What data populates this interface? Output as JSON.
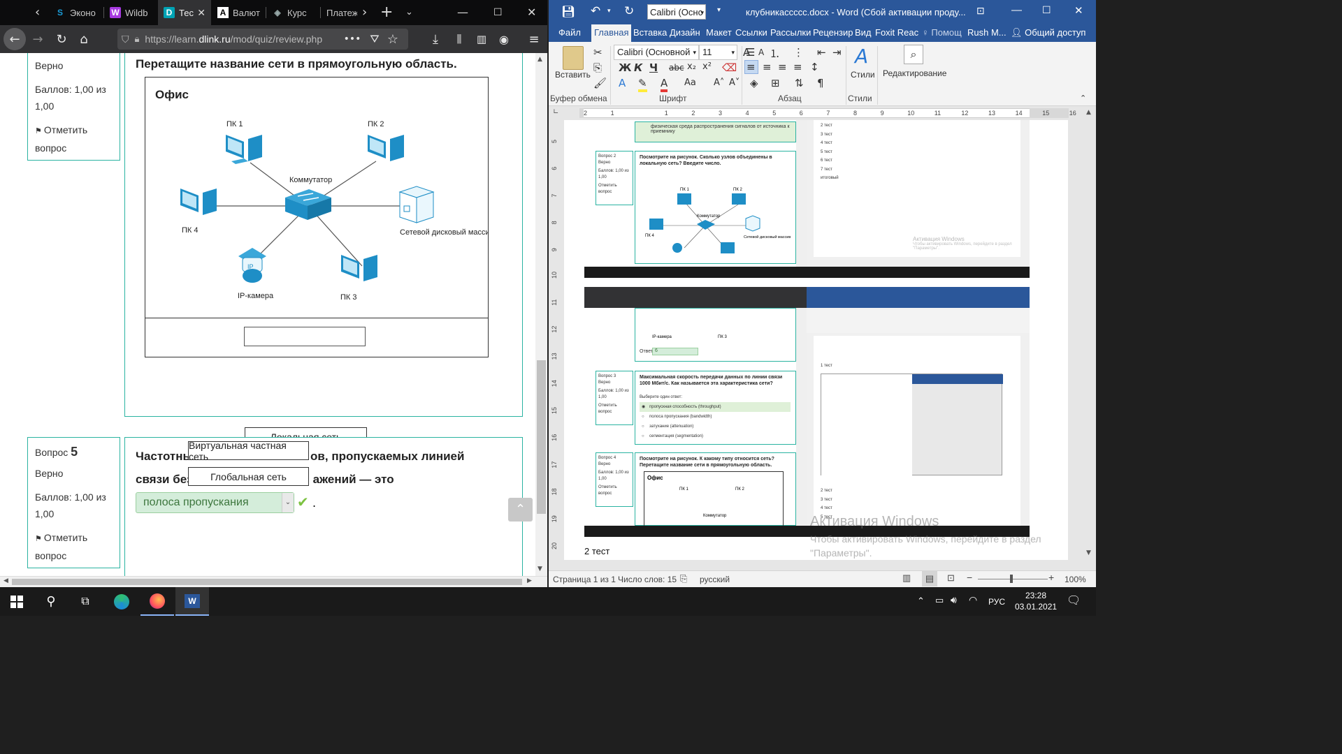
{
  "firefox": {
    "tabs": [
      {
        "label": "Эконо",
        "favicon": "S",
        "color": "#1a9bd7"
      },
      {
        "label": "Wildb",
        "favicon": "W",
        "color": "#a73ae0"
      },
      {
        "label": "Тес",
        "favicon": "D",
        "color": "#00a3b4"
      },
      {
        "label": "Валют",
        "favicon": "A",
        "color": "#ffffff"
      },
      {
        "label": "Курс",
        "favicon": "◈",
        "color": "#9aa"
      },
      {
        "label": "Платеж",
        "favicon": "",
        "color": "#ccc"
      }
    ],
    "url": {
      "prefix": "https://learn.",
      "host": "dlink.ru",
      "path": "/mod/quiz/review.php"
    },
    "q4": {
      "status": "Верно",
      "score": "Баллов: 1,00 из 1,00",
      "flag": "Отметить вопрос",
      "text": "Перетащите название сети в прямоугольную область.",
      "diagram": {
        "title": "Офис",
        "pc1": "ПК 1",
        "pc2": "ПК 2",
        "pc3": "ПК 3",
        "pc4": "ПК 4",
        "switch": "Коммутатор",
        "nas": "Сетевой дисковый массив",
        "camera": "IP-камера",
        "cam_ip": "IP"
      },
      "answer_option": "Локальная сеть"
    },
    "q5": {
      "label": "Вопрос",
      "number": "5",
      "status": "Верно",
      "score": "Баллов: 1,00 из 1,00",
      "flag": "Отметить вопрос",
      "text_line1": "Частотны",
      "text_line1_end": "ов, пропускаемых линией",
      "text_line2_start": "связи без",
      "text_line2_end": "ажений — это",
      "selected": "полоса пропускания",
      "drag1": "Виртуальная частная сеть",
      "drag2": "Глобальная сеть"
    }
  },
  "word": {
    "title": "клубникассссс.docx - Word (Сбой активации проду...",
    "font_combo": "Calibri (Оснс",
    "menu": [
      "Файл",
      "Главная",
      "Вставка",
      "Дизайн",
      "Макет",
      "Ссылки",
      "Рассылки",
      "Рецензир",
      "Вид",
      "Foxit Reac",
      "Помощ",
      "Rush M...",
      "Общий доступ"
    ],
    "ribbon": {
      "paste": "Вставить",
      "font_name": "Calibri (Основной",
      "font_size": "11",
      "styles": "Стили",
      "editing": "Редактирование",
      "groups": [
        "Буфер обмена",
        "Шрифт",
        "Абзац",
        "Стили"
      ]
    },
    "doc": {
      "q2_label": "Вопрос 2",
      "q2_status": "Верно",
      "q2_score": "Баллов: 1,00 из 1,00",
      "q2_flag": "Отметить вопрос",
      "q2_text": "Посмотрите на рисунок. Сколько узлов объединены в локальную сеть? Введите число.",
      "q2_diagram": {
        "pc1": "ПК 1",
        "pc2": "ПК 2",
        "pc4": "ПК 4",
        "switch": "Коммутатор",
        "nas": "Сетевой дисковый массив"
      },
      "q1_answer": "физическая среда распространения сигналов от источника к приемнику",
      "answer_label": "Ответ:",
      "answer_value": "6",
      "q3_label": "Вопрос 3",
      "q3_status": "Верно",
      "q3_score": "Баллов: 1,00 из 1,00",
      "q3_flag": "Отметить вопрос",
      "q3_text": "Максимальная скорость передачи данных по линии связи 1000 Мбит/с. Как называется эта характеристика сети?",
      "q3_choose": "Выберите один ответ:",
      "q3_options": [
        "пропускная способность (throughput)",
        "полоса пропускания (bandwidth)",
        "затухание (attenuation)",
        "сегментация (segmentation)"
      ],
      "q4_label": "Вопрос 4",
      "q4_status": "Верно",
      "q4_score": "Баллов: 1,00 из 1,00",
      "q4_flag": "Отметить вопрос",
      "q4_text": "Посмотрите на рисунок. К какому типу относится сеть? Перетащите название сети в прямоугольную область.",
      "q4_office": "Офис",
      "q4_pc1": "ПК 1",
      "q4_pc2": "ПК 2",
      "q4_switch": "Коммутатор",
      "cam": "IP-камера",
      "pc3": "ПК 3",
      "side_list_top": [
        "2 тест",
        "3 тест",
        "4 тест",
        "5 тест",
        "6 тест",
        "7 тест",
        "итоговый"
      ],
      "side_list_bottom": [
        "2 тест",
        "3 тест",
        "4 тест",
        "5 тест"
      ],
      "test1": "1 тест",
      "activation_small_title": "Активация Windows",
      "activation_small_sub": "Чтобы активировать Windows, перейдите в раздел \"Параметры\".",
      "bottom_line": "2 тест",
      "activation_title": "Активация Windows",
      "activation_sub1": "Чтобы активировать Windows, перейдите в раздел",
      "activation_sub2": "\"Параметры\"."
    },
    "status": {
      "page": "Страница 1 из 1",
      "words": "Число слов: 15",
      "lang": "русский",
      "zoom": "100%"
    }
  },
  "taskbar": {
    "lang": "РУС",
    "time": "23:28",
    "date": "03.01.2021"
  }
}
